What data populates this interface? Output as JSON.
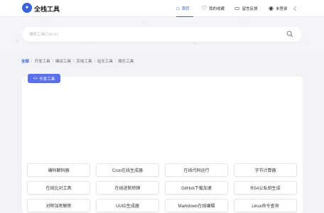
{
  "header": {
    "site_title": "全栈工具",
    "logo_icon": "logo-icon",
    "nav": {
      "home": "首页",
      "favorites": "我的收藏",
      "messages": "留言反馈",
      "login": "未登录"
    },
    "accent_color": "#3b63d9"
  },
  "search": {
    "placeholder": "搜索工具(Ctrl+F)"
  },
  "categories": [
    "全部",
    "开发工具",
    "编译工具",
    "实用工具",
    "站长工具",
    "娱乐工具"
  ],
  "active_category": "全部",
  "section": {
    "tag_label": "开发工具",
    "tag_icon": "code-icon"
  },
  "tools": [
    "编码解码器",
    "Cron在线生成器",
    "在线代码运行",
    "字节计算器",
    "在线比对工具",
    "在线进制转换",
    "GitHub下载加速",
    "RSA公私钥生成",
    "对称加密解密",
    "UUID生成器",
    "Markdown在线编辑",
    "Linux命令查询"
  ]
}
